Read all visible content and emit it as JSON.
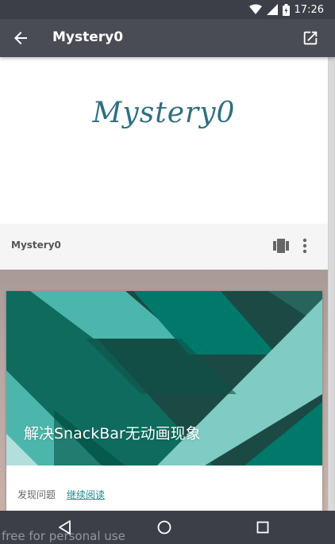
{
  "status_bar": {
    "time": "17:26",
    "icons": [
      "wifi-icon",
      "signal-icon",
      "battery-icon"
    ]
  },
  "app_bar": {
    "title": "Mystery0",
    "icons": [
      "back-arrow-icon",
      "open-external-icon"
    ]
  },
  "logo": {
    "text": "Mystery0"
  },
  "card_header": {
    "name": "Mystery0",
    "icons": [
      "film-icon",
      "more-vert-icon"
    ]
  },
  "post": {
    "title": "解决SnackBar无动画现象",
    "tag": "发现问题",
    "read_more": "继续阅读"
  },
  "nav_bar": {
    "icons": [
      "back-triangle-icon",
      "home-circle-icon",
      "recents-square-icon"
    ]
  },
  "watermark": "free for personal use",
  "colors": {
    "status_bar": "#3d3f48",
    "app_bar": "#4a4c55",
    "logo_text": "#2f6f80",
    "accent_link": "#1a8a8a"
  }
}
